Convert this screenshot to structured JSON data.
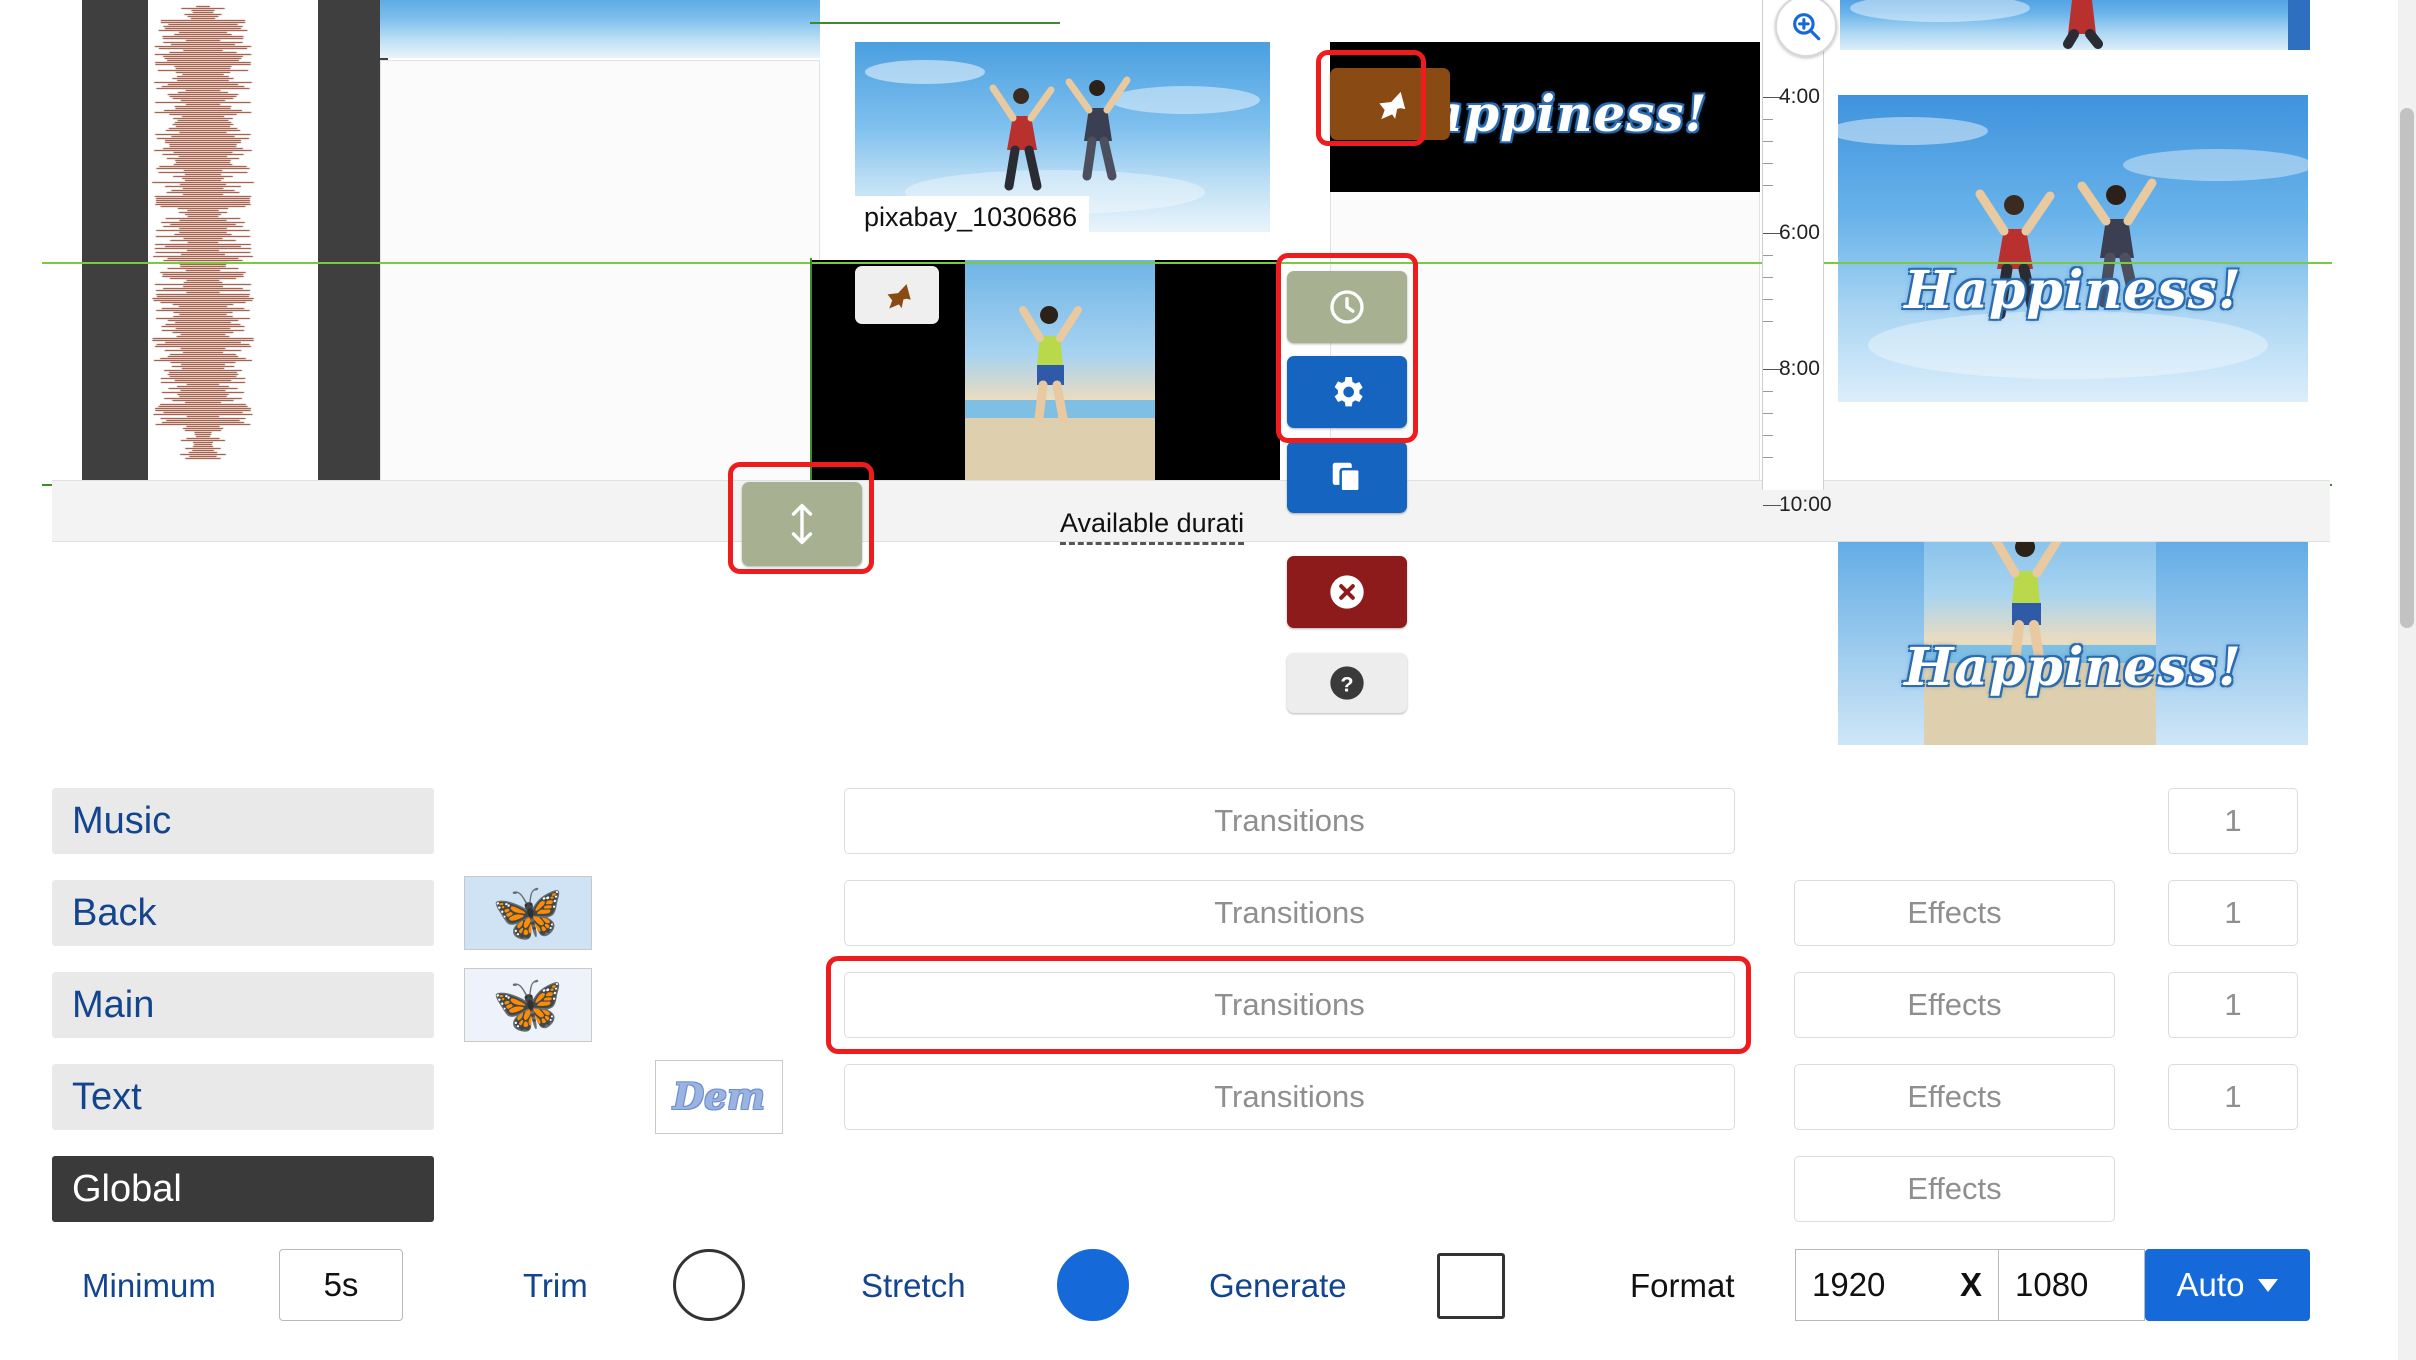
{
  "app": {
    "tooltip_filename": "pixabay_1030686",
    "available_duration_label": "Available durati"
  },
  "ruler": {
    "ticks": [
      "4:00",
      "6:00",
      "8:00",
      "10:00"
    ],
    "zoom_icon": "magnifier-zoom-icon"
  },
  "preview": {
    "caption_text": "Happiness!"
  },
  "toolbar": {
    "buttons": [
      {
        "name": "pin-button",
        "icon": "pushpin-icon",
        "color": "#8a4a13"
      },
      {
        "name": "clock-button",
        "icon": "clock-icon",
        "color": "#a7b191"
      },
      {
        "name": "settings-button",
        "icon": "gear-icon",
        "color": "#1565c0"
      },
      {
        "name": "duplicate-button",
        "icon": "copy-icon",
        "color": "#1565c0"
      },
      {
        "name": "delete-button",
        "icon": "close-circle-icon",
        "color": "#8e1b1b"
      },
      {
        "name": "help-button",
        "icon": "question-mark-icon",
        "color": "#ededed"
      }
    ],
    "resize-handle": {
      "name": "vertical-resize-handle",
      "icon": "up-down-arrow-icon",
      "color": "#a7b191"
    },
    "clip-pin": {
      "name": "clip-pin-button",
      "icon": "pushpin-icon",
      "color": "#efefef"
    }
  },
  "channels": [
    {
      "label": "Music",
      "transitions": "Transitions",
      "effects": null,
      "count": "1"
    },
    {
      "label": "Back",
      "transitions": "Transitions",
      "effects": "Effects",
      "count": "1"
    },
    {
      "label": "Main",
      "transitions": "Transitions",
      "effects": "Effects",
      "count": "1"
    },
    {
      "label": "Text",
      "transitions": "Transitions",
      "effects": "Effects",
      "count": "1"
    },
    {
      "label": "Global",
      "transitions": null,
      "effects": "Effects",
      "count": null
    }
  ],
  "thumbs": {
    "back": "butterfly-thumbnail",
    "main": "butterfly-thumbnail",
    "text": "Dem"
  },
  "controls": {
    "minimum_label": "Minimum",
    "minimum_value": "5s",
    "trim_label": "Trim",
    "trim_selected": false,
    "stretch_label": "Stretch",
    "stretch_selected": true,
    "generate_label": "Generate",
    "generate_selected": false,
    "format_label": "Format",
    "format_width": "1920",
    "format_x": "X",
    "format_height": "1080",
    "auto_label": "Auto"
  },
  "colors": {
    "accent_blue": "#1669d8",
    "link_blue": "#13458f",
    "annotation_red": "#ee1c1c",
    "olive": "#a7b191",
    "danger_red": "#8e1b1b",
    "brown": "#8a4a13"
  }
}
